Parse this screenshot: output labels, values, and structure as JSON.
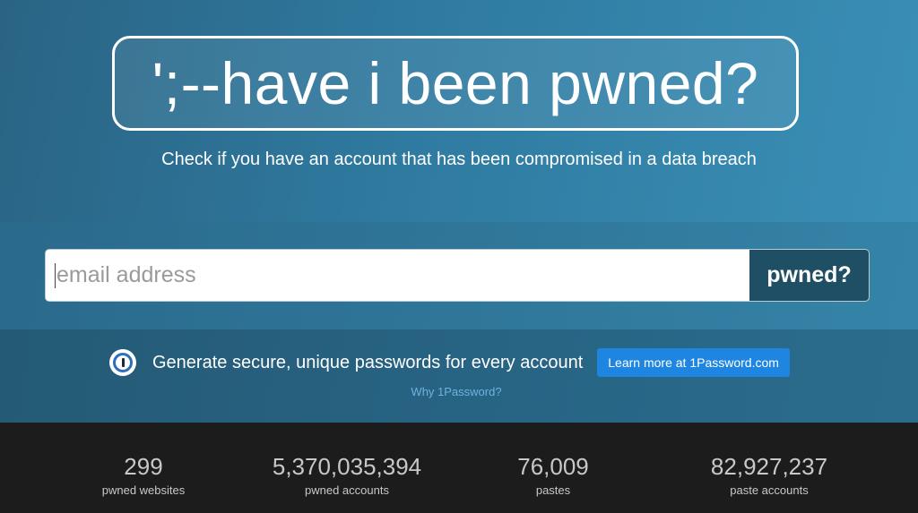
{
  "hero": {
    "title": "';--have i been pwned?",
    "tagline": "Check if you have an account that has been compromised in a data breach"
  },
  "search": {
    "placeholder": "email address",
    "button_label": "pwned?"
  },
  "promo": {
    "icon": "1password-icon",
    "text": "Generate secure, unique passwords for every account",
    "button_label": "Learn more at 1Password.com",
    "link_label": "Why 1Password?"
  },
  "stats": [
    {
      "value": "299",
      "label": "pwned websites"
    },
    {
      "value": "5,370,035,394",
      "label": "pwned accounts"
    },
    {
      "value": "76,009",
      "label": "pastes"
    },
    {
      "value": "82,927,237",
      "label": "paste accounts"
    }
  ],
  "colors": {
    "hero_bg": "#2f7aa0",
    "button_bg": "#1f4f64",
    "promo_button": "#1e86e0",
    "link": "#6fb2de",
    "stats_bg": "#1c1c1c"
  }
}
